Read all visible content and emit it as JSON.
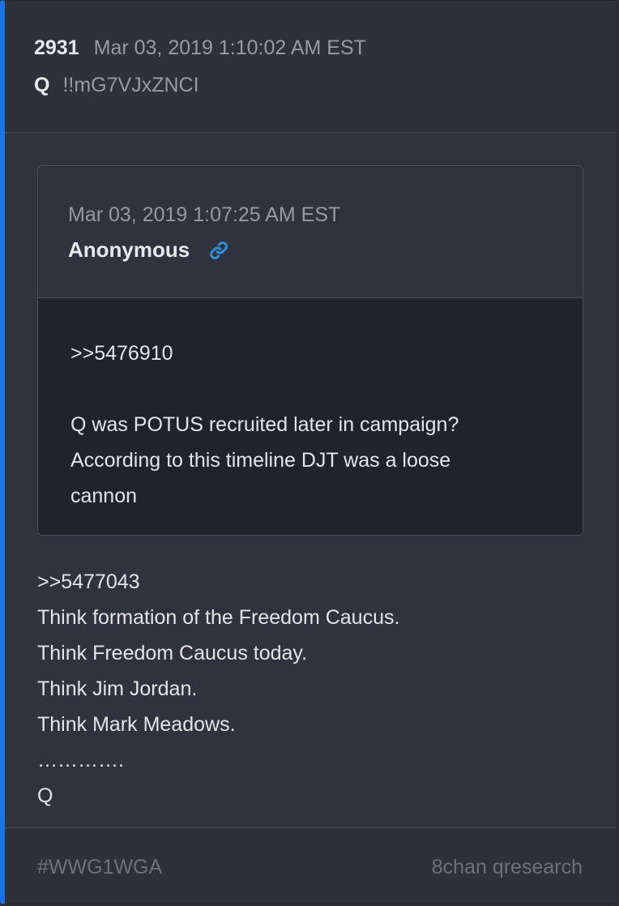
{
  "post": {
    "number": "2931",
    "date": "Mar 03, 2019 1:10:02 AM EST",
    "author": "Q",
    "tripcode": "!!mG7VJxZNCI"
  },
  "quoted": {
    "date": "Mar 03, 2019 1:07:25 AM EST",
    "author": "Anonymous",
    "link_icon": "link-icon",
    "lines": [
      ">>5476910",
      "",
      "Q was POTUS recruited later in campaign?",
      "According to this timeline DJT was a loose",
      "cannon"
    ]
  },
  "body": {
    "lines": [
      ">>5477043",
      "Think formation of the Freedom Caucus.",
      "Think Freedom Caucus today.",
      "Think Jim Jordan.",
      "Think Mark Meadows.",
      "………….",
      "Q"
    ]
  },
  "footer": {
    "hashtag": "#WWG1WGA",
    "source": "8chan qresearch"
  },
  "colors": {
    "accent": "#1a73e8",
    "link": "#2f8fd8",
    "background": "#2e333d",
    "quote_body": "#20232a"
  }
}
